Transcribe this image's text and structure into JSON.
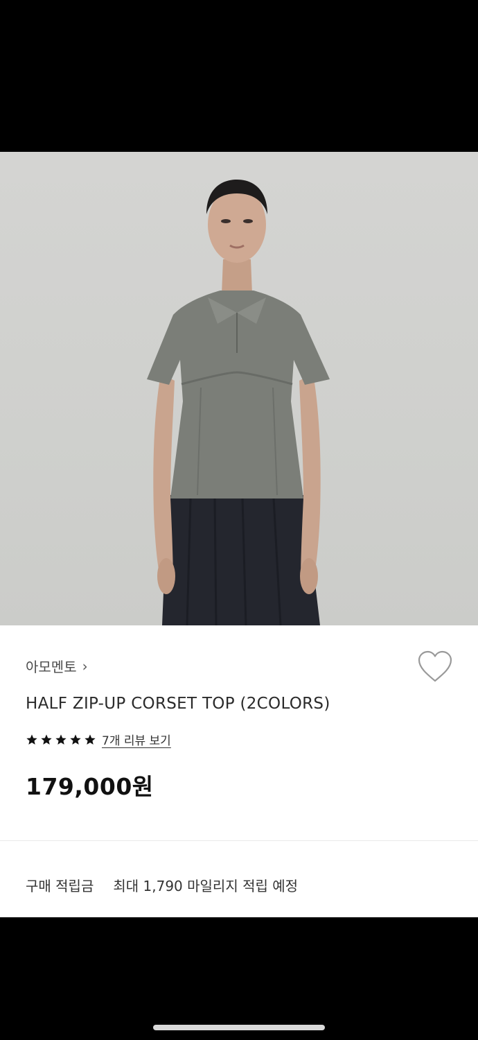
{
  "product": {
    "brand": "아모멘토",
    "brand_chevron": "›",
    "title": "HALF ZIP-UP CORSET TOP (2COLORS)",
    "rating_stars": 5,
    "review_link": "7개 리뷰 보기",
    "price": "179,000원"
  },
  "points": {
    "label": "구매 적립금",
    "value": "최대 1,790 마일리지 적립 예정"
  },
  "icons": {
    "wishlist": "heart-outline-icon",
    "star": "star-filled-icon"
  },
  "colors": {
    "accent": "#111111",
    "divider": "#e9e9e9",
    "heart_stroke": "#999999"
  }
}
